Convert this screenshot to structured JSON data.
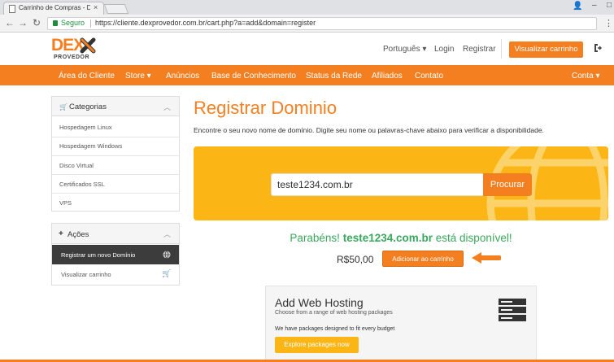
{
  "browser": {
    "tab_title": "Carrinho de Compras - D",
    "tab_close": "×",
    "secure_label": "Seguro",
    "url": "https://cliente.dexprovedor.com.br/cart.php?a=add&domain=register"
  },
  "header": {
    "logo_main": "DEX",
    "logo_sub": "PROVEDOR",
    "language": "Português ▾",
    "login": "Login",
    "register": "Registrar",
    "cart_button": "Visualizar carrinho"
  },
  "nav": {
    "items": [
      "Área do Cliente",
      "Store ▾",
      "Anúncios",
      "Base de Conhecimento",
      "Status da Rede",
      "Afiliados",
      "Contato"
    ],
    "account": "Conta ▾"
  },
  "sidebar": {
    "categories_title": "Categorias",
    "categories": [
      "Hospedagem Linux",
      "Hospedagem Windows",
      "Disco Virtual",
      "Certificados SSL",
      "VPS"
    ],
    "actions_title": "Ações",
    "actions": [
      "Registrar um novo Domínio",
      "Visualizar carrinho"
    ]
  },
  "main": {
    "title": "Registrar Dominio",
    "description": "Encontre o seu novo nome de domínio. Digite seu nome ou palavras-chave abaixo para verificar a disponibilidade.",
    "search_value": "teste1234.com.br",
    "search_button": "Procurar",
    "available_prefix": "Parabéns!",
    "available_domain": "teste1234.com.br",
    "available_suffix": "está disponível!",
    "price": "R$50,00",
    "add_to_cart": "Adicionar ao carrinho"
  },
  "hosting": {
    "title": "Add Web Hosting",
    "subtitle": "Choose from a range of web hosting packages",
    "note": "We have packages designed to fit every budget",
    "button": "Explore packages now"
  },
  "colors": {
    "brand_orange": "#f47f20",
    "banner_yellow": "#fbb514",
    "success_green": "#3aa75d",
    "sidebar_active": "#3c3c3c"
  }
}
